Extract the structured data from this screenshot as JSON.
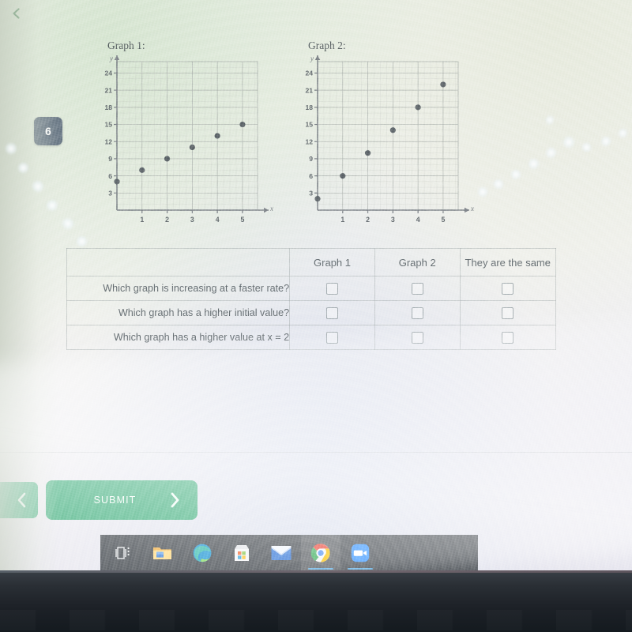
{
  "app": {
    "back_label": "Back",
    "question_number": "6",
    "accent_green": "#35a772",
    "badge_color": "#5d6b7a"
  },
  "graphs": [
    {
      "title": "Graph 1:",
      "x_axis_label": "x",
      "y_axis_label": "y",
      "x_ticks": [
        "1",
        "2",
        "3",
        "4",
        "5"
      ],
      "y_ticks": [
        "3",
        "6",
        "9",
        "12",
        "15",
        "18",
        "21",
        "24"
      ]
    },
    {
      "title": "Graph 2:",
      "x_axis_label": "x",
      "y_axis_label": "y",
      "x_ticks": [
        "1",
        "2",
        "3",
        "4",
        "5"
      ],
      "y_ticks": [
        "3",
        "6",
        "9",
        "12",
        "15",
        "18",
        "21",
        "24"
      ]
    }
  ],
  "chart_data": [
    {
      "type": "scatter",
      "title": "Graph 1:",
      "xlabel": "x",
      "ylabel": "y",
      "x": [
        0,
        1,
        2,
        3,
        4,
        5
      ],
      "values": [
        5,
        7,
        9,
        11,
        13,
        15
      ],
      "xlim": [
        0,
        5.6
      ],
      "ylim": [
        0,
        26
      ],
      "xticks": [
        1,
        2,
        3,
        4,
        5
      ],
      "yticks": [
        3,
        6,
        9,
        12,
        15,
        18,
        21,
        24
      ],
      "grid": true,
      "legend": "none",
      "slope": 2,
      "intercept": 5
    },
    {
      "type": "scatter",
      "title": "Graph 2:",
      "xlabel": "x",
      "ylabel": "y",
      "x": [
        0,
        1,
        2,
        3,
        4,
        5
      ],
      "values": [
        2,
        6,
        10,
        14,
        18,
        22
      ],
      "xlim": [
        0,
        5.6
      ],
      "ylim": [
        0,
        26
      ],
      "xticks": [
        1,
        2,
        3,
        4,
        5
      ],
      "yticks": [
        3,
        6,
        9,
        12,
        15,
        18,
        21,
        24
      ],
      "grid": true,
      "legend": "none",
      "slope": 4,
      "intercept": 2
    }
  ],
  "table": {
    "headers": [
      "",
      "Graph 1",
      "Graph 2",
      "They are the same"
    ],
    "rows": [
      {
        "question": "Which graph is increasing at a faster rate?",
        "checked": [
          false,
          false,
          false
        ]
      },
      {
        "question": "Which graph has a higher initial value?",
        "checked": [
          false,
          false,
          false
        ]
      },
      {
        "question": "Which graph has a higher value at x = 2",
        "checked": [
          false,
          false,
          false
        ]
      }
    ]
  },
  "footer": {
    "previous_label": "Previous",
    "submit_label": "SUBMIT",
    "next_label": "Next"
  },
  "taskbar": {
    "items": [
      {
        "name": "task-view",
        "label": "Task View",
        "active": false,
        "underline": false
      },
      {
        "name": "file-explorer",
        "label": "File Explorer",
        "active": false,
        "underline": false
      },
      {
        "name": "microsoft-edge",
        "label": "Microsoft Edge",
        "active": false,
        "underline": false
      },
      {
        "name": "microsoft-store",
        "label": "Microsoft Store",
        "active": false,
        "underline": false
      },
      {
        "name": "mail",
        "label": "Mail",
        "active": false,
        "underline": false
      },
      {
        "name": "google-chrome",
        "label": "Google Chrome",
        "active": true,
        "underline": true
      },
      {
        "name": "zoom",
        "label": "Zoom",
        "active": false,
        "underline": true
      }
    ]
  }
}
